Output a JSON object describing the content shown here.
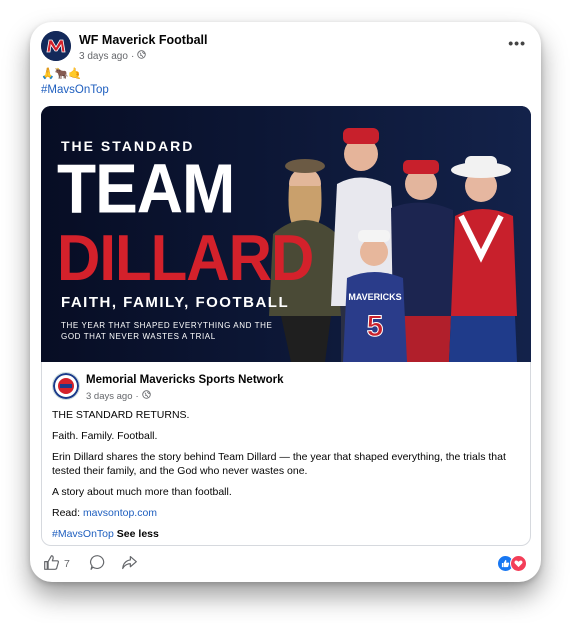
{
  "post": {
    "page_name": "WF Maverick Football",
    "time": "3 days ago",
    "privacy_sep": "·",
    "emojis": "🙏🐂🤙",
    "hashtag": "#MavsOnTop",
    "more": "•••"
  },
  "graphic": {
    "line1": "THE STANDARD",
    "line2": "TEAM",
    "line3": "DILLARD",
    "line4": "FAITH, FAMILY, FOOTBALL",
    "line5": "THE YEAR THAT SHAPED EVERYTHING AND THE GOD THAT NEVER WASTES A TRIAL",
    "jersey_text": "MAVERICKS",
    "jersey_number": "5"
  },
  "shared": {
    "name": "Memorial Mavericks Sports Network",
    "time": "3 days ago",
    "privacy_sep": "·",
    "p1": "THE STANDARD RETURNS.",
    "p2": "Faith. Family. Football.",
    "p3": "Erin Dillard shares the story behind Team Dillard — the year that shaped everything, the trials that tested their family, and the God who never wastes one.",
    "p4": "A story about much more than football.",
    "read_label": "Read: ",
    "read_link": "mavsontop.com",
    "hashtag": "#MavsOnTop",
    "see_less": "See less"
  },
  "footer": {
    "likes": "7"
  },
  "colors": {
    "link": "#1f5fbf",
    "brand_red": "#d4212b",
    "navy": "#0a1330"
  }
}
